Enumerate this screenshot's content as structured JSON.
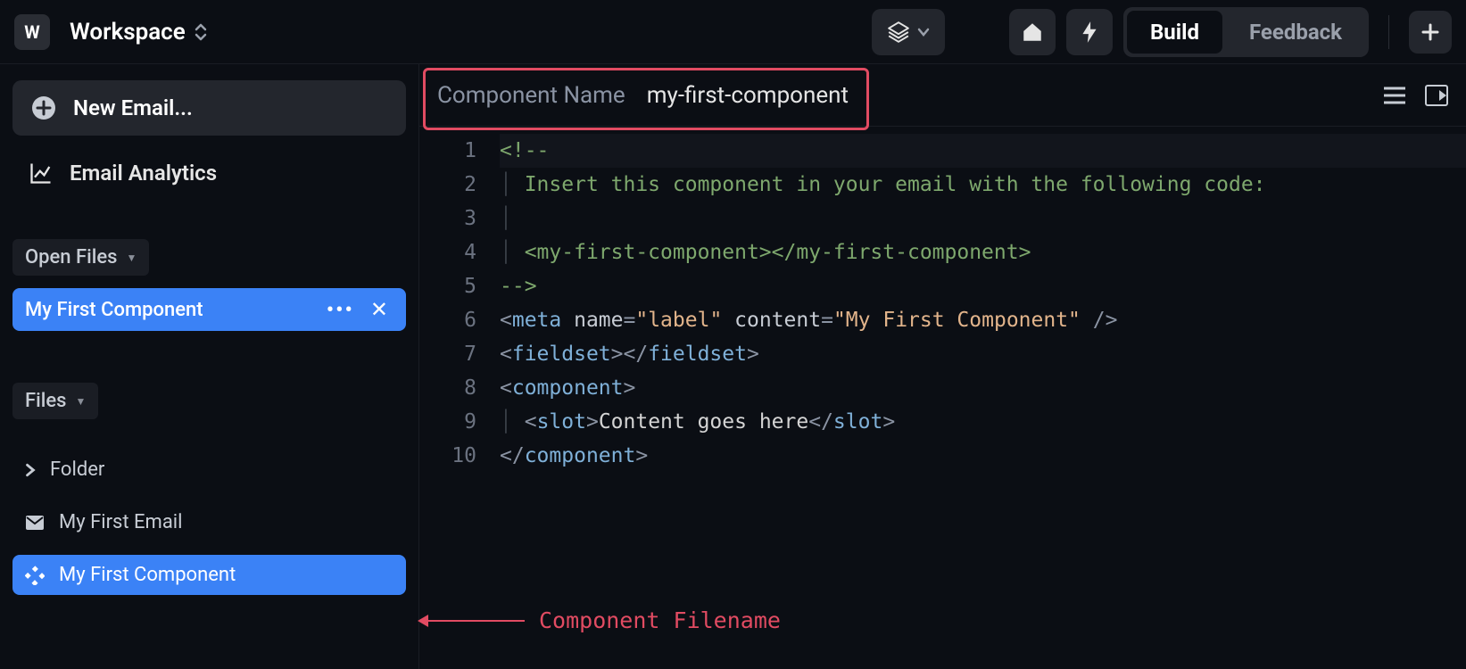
{
  "topbar": {
    "logo_letter": "W",
    "workspace_label": "Workspace",
    "tabs": {
      "build": "Build",
      "feedback": "Feedback"
    }
  },
  "sidebar": {
    "new_email_label": "New Email...",
    "analytics_label": "Email Analytics",
    "open_files_header": "Open Files",
    "open_file_name": "My First Component",
    "files_header": "Files",
    "files": [
      {
        "name": "Folder",
        "type": "folder"
      },
      {
        "name": "My First Email",
        "type": "email"
      },
      {
        "name": "My First Component",
        "type": "component",
        "selected": true
      }
    ]
  },
  "editor": {
    "component_name_label": "Component Name",
    "component_name_value": "my-first-component",
    "annotation_label": "Component Filename",
    "lines": [
      "1",
      "2",
      "3",
      "4",
      "5",
      "6",
      "7",
      "8",
      "9",
      "10"
    ],
    "code": {
      "l1": "<!--",
      "l2": "Insert this component in your email with the following code:",
      "l4": "<my-first-component></my-first-component>",
      "l5": "-->",
      "tag_meta": "meta",
      "attr_name": "name",
      "attr_content": "content",
      "val_label": "\"label\"",
      "val_content": "\"My First Component\"",
      "tag_fieldset": "fieldset",
      "tag_component": "component",
      "tag_slot": "slot",
      "slot_text": "Content goes here"
    }
  }
}
